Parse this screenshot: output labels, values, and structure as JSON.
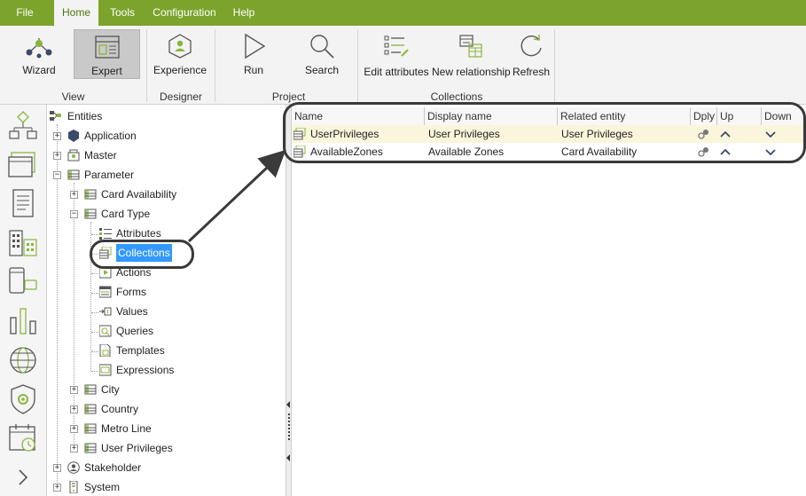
{
  "menu": {
    "items": [
      {
        "label": "File",
        "active": false
      },
      {
        "label": "Home",
        "active": true
      },
      {
        "label": "Tools",
        "active": false
      },
      {
        "label": "Configuration",
        "active": false
      },
      {
        "label": "Help",
        "active": false
      }
    ]
  },
  "ribbon": {
    "groups": {
      "view": "View",
      "designer": "Designer",
      "project": "Project",
      "collections": "Collections"
    },
    "buttons": {
      "wizard": "Wizard",
      "expert": "Expert",
      "experience": "Experience",
      "run": "Run",
      "search": "Search",
      "edit_attributes": "Edit attributes",
      "new_relationship": "New relationship",
      "refresh": "Refresh"
    }
  },
  "tree": {
    "root": "Entities",
    "application": "Application",
    "master": "Master",
    "parameter": "Parameter",
    "card_availability": "Card Availability",
    "card_type": "Card Type",
    "attributes": "Attributes",
    "collections": "Collections",
    "actions": "Actions",
    "forms": "Forms",
    "values": "Values",
    "queries": "Queries",
    "templates": "Templates",
    "expressions": "Expressions",
    "city": "City",
    "country": "Country",
    "metro_line": "Metro Line",
    "user_privileges": "User Privileges",
    "stakeholder": "Stakeholder",
    "system": "System"
  },
  "grid": {
    "columns": {
      "name": "Name",
      "display_name": "Display name",
      "related_entity": "Related entity",
      "dply": "Dply",
      "up": "Up",
      "down": "Down"
    },
    "rows": [
      {
        "name": "UserPrivileges",
        "display_name": "User Privileges",
        "related_entity": "User Privileges"
      },
      {
        "name": "AvailableZones",
        "display_name": "Available Zones",
        "related_entity": "Card Availability"
      }
    ]
  },
  "colors": {
    "menubar": "#7ca32b",
    "accent_green": "#8ab53c",
    "selection": "#3399ff",
    "selected_row": "#fbf5dc"
  }
}
